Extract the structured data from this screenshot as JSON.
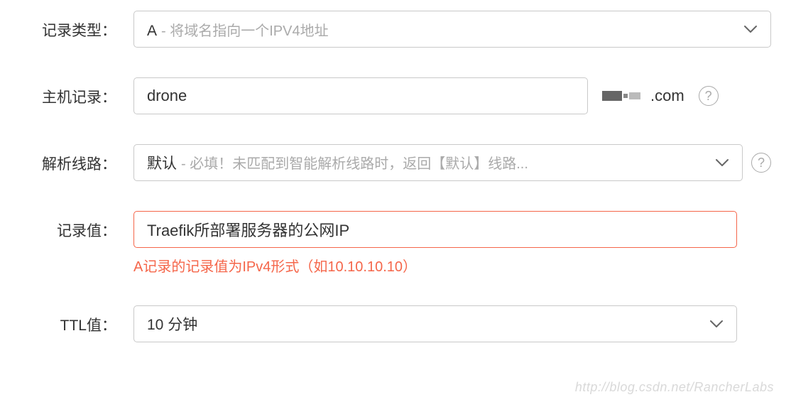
{
  "record_type": {
    "label": "记录类型：",
    "value": "A",
    "desc": "- 将域名指向一个IPV4地址"
  },
  "host_record": {
    "label": "主机记录：",
    "value": "drone",
    "domain_suffix": ".com",
    "help": "?"
  },
  "resolve_line": {
    "label": "解析线路：",
    "value": "默认",
    "desc": "- 必填！未匹配到智能解析线路时，返回【默认】线路...",
    "help": "?"
  },
  "record_value": {
    "label": "记录值：",
    "value": "Traefik所部署服务器的公网IP",
    "error_hint": "A记录的记录值为IPv4形式（如10.10.10.10）"
  },
  "ttl": {
    "label": "TTL值：",
    "value": "10 分钟"
  },
  "watermark": "http://blog.csdn.net/RancherLabs"
}
